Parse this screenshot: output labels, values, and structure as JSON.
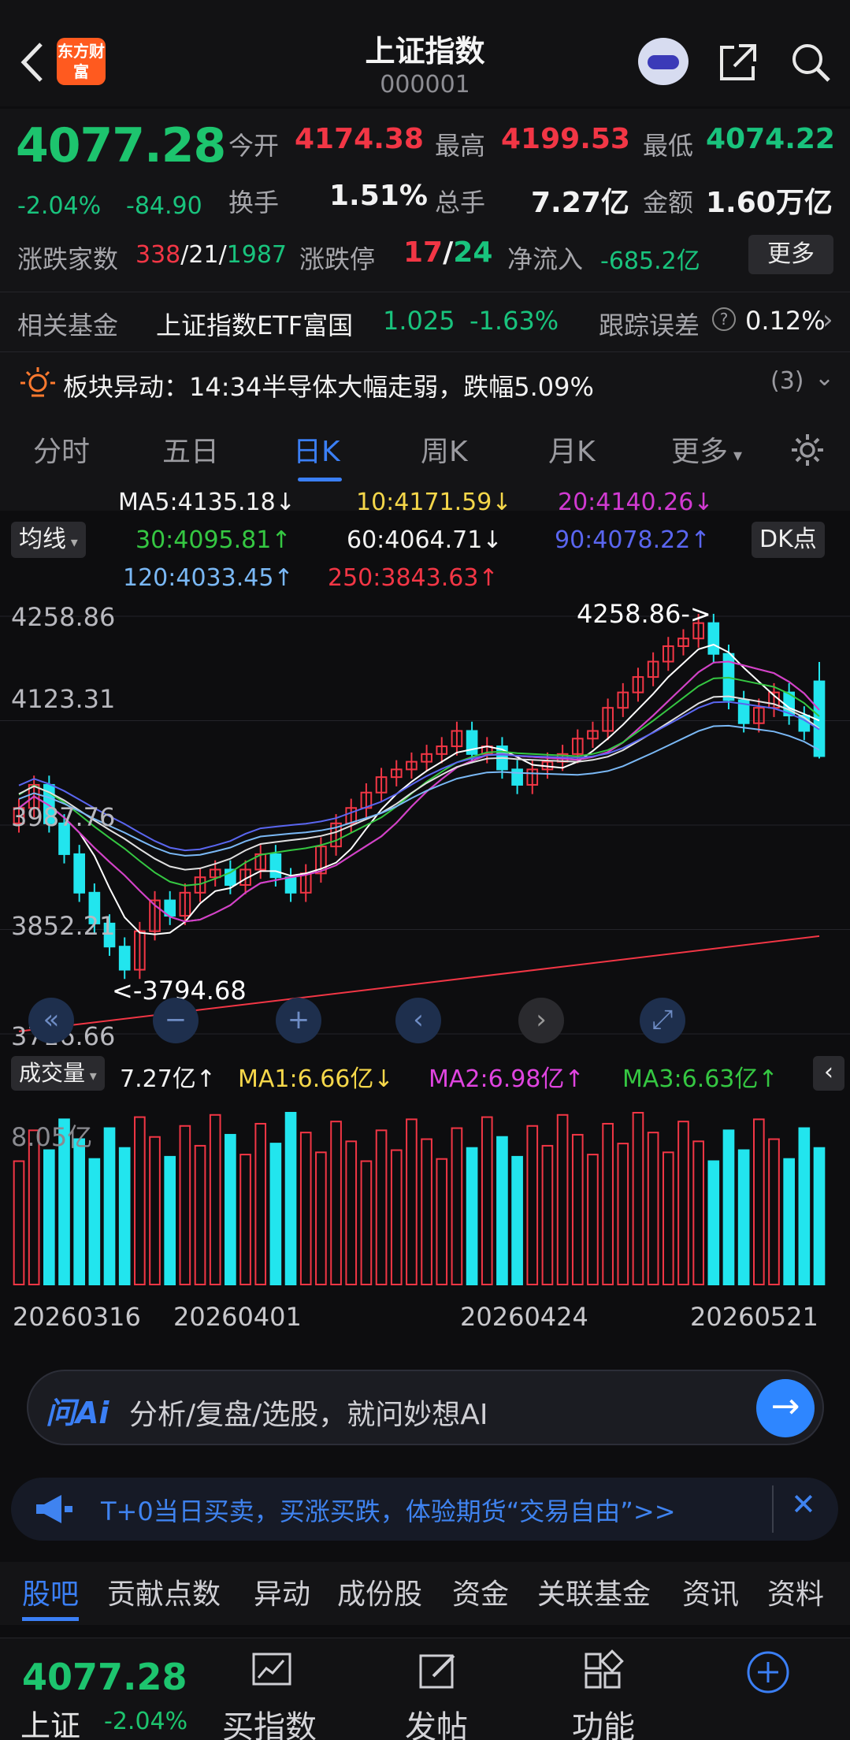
{
  "header": {
    "title": "上证指数",
    "code": "000001",
    "logo_text": "东方财富"
  },
  "quote": {
    "price": "4077.28",
    "change_pct": "-2.04%",
    "change": "-84.90",
    "open_label": "今开",
    "open": "4174.38",
    "high_label": "最高",
    "high": "4199.53",
    "low_label": "最低",
    "low": "4074.22",
    "turnover_label": "换手",
    "turnover": "1.51%",
    "volume_label": "总手",
    "volume": "7.27亿",
    "amount_label": "金额",
    "amount": "1.60万亿",
    "breadth_label": "涨跌家数",
    "breadth_up": "338",
    "breadth_flat": "21",
    "breadth_down": "1987",
    "limit_label": "涨跌停",
    "limit_up": "17",
    "limit_down": "24",
    "netflow_label": "净流入",
    "netflow": "-685.2亿",
    "more_label": "更多",
    "fund_label": "相关基金",
    "fund_name": "上证指数ETF富国",
    "fund_price": "1.025",
    "fund_change": "-1.63%",
    "tracking_label": "跟踪误差",
    "tracking_value": "0.12%",
    "alert_text": "板块异动：14:34半导体大幅走弱，跌幅5.09%",
    "alert_count": "(3)"
  },
  "tabs": [
    {
      "label": "分时"
    },
    {
      "label": "五日"
    },
    {
      "label": "日K"
    },
    {
      "label": "周K"
    },
    {
      "label": "月K"
    },
    {
      "label": "更多"
    }
  ],
  "ma": {
    "ma5": "MA5:4135.18↓",
    "ma10": "10:4171.59↓",
    "ma20": "20:4140.26↓",
    "ma30": "30:4095.81↑",
    "ma60": "60:4064.71↓",
    "ma90": "90:4078.22↑",
    "ma120": "120:4033.45↑",
    "ma250": "250:3843.63↑",
    "mode_label": "均线",
    "dk_label": "DK点"
  },
  "chart": {
    "y_top": "4258.86",
    "y_mid1": "4123.31",
    "y_mid2": "3987.76",
    "y_mid3": "3852.21",
    "y_bottom": "3716.66",
    "high_marker": "4258.86->",
    "low_marker": "<-3794.68",
    "vol_label": "成交量",
    "vol_value": "7.27亿↑",
    "vol_ma1": "MA1:6.66亿↓",
    "vol_ma2": "MA2:6.98亿↑",
    "vol_ma3": "MA3:6.63亿↑",
    "vol_axis": "8.05亿",
    "dates": [
      "20260316",
      "20260401",
      "20260424",
      "20260521"
    ]
  },
  "chart_data": {
    "type": "candlestick",
    "x": [
      "20260316",
      "20260401",
      "20260424",
      "20260521"
    ],
    "ylim": [
      3716.66,
      4258.86
    ],
    "yticks": [
      4258.86,
      4123.31,
      3987.76,
      3852.21,
      3716.66
    ],
    "high": 4258.86,
    "low": 3794.68,
    "last": {
      "open": 4174.38,
      "high": 4199.53,
      "low": 4074.22,
      "close": 4077.28
    },
    "ma": {
      "MA5": 4135.18,
      "MA10": 4171.59,
      "MA20": 4140.26,
      "MA30": 4095.81,
      "MA60": 4064.71,
      "MA90": 4078.22,
      "MA120": 4033.45,
      "MA250": 3843.63
    },
    "closes": [
      4010,
      4040,
      3990,
      3950,
      3900,
      3860,
      3830,
      3800,
      3850,
      3890,
      3870,
      3900,
      3920,
      3930,
      3910,
      3930,
      3950,
      3920,
      3900,
      3925,
      3960,
      3990,
      4010,
      4030,
      4050,
      4060,
      4070,
      4080,
      4090,
      4110,
      4080,
      4090,
      4060,
      4040,
      4060,
      4070,
      4080,
      4100,
      4110,
      4140,
      4160,
      4180,
      4200,
      4220,
      4230,
      4250,
      4210,
      4150,
      4120,
      4140,
      4160,
      4130,
      4110,
      4077.28
    ],
    "volume": {
      "current": "7.27亿",
      "MA1": "6.66亿",
      "MA2": "6.98亿",
      "MA3": "6.63亿",
      "axis_max": "8.05亿"
    }
  },
  "ai": {
    "tag": "问Ai",
    "placeholder": "分析/复盘/选股，就问妙想AI"
  },
  "promo": {
    "text": "T+0当日买卖，买涨买跌，体验期货“交易自由”>>"
  },
  "bottom_tabs": [
    "股吧",
    "贡献点数",
    "异动",
    "成份股",
    "资金",
    "关联基金",
    "资讯",
    "资料"
  ],
  "bottom_bar": {
    "price": "4077.28",
    "name": "上证",
    "change_pct": "-2.04%",
    "buy_label": "买指数",
    "post_label": "发帖",
    "func_label": "功能"
  },
  "colors": {
    "up": "#f23645",
    "down": "#19c37d",
    "accent": "#3b7ff5",
    "cyan": "#22e5ee"
  }
}
